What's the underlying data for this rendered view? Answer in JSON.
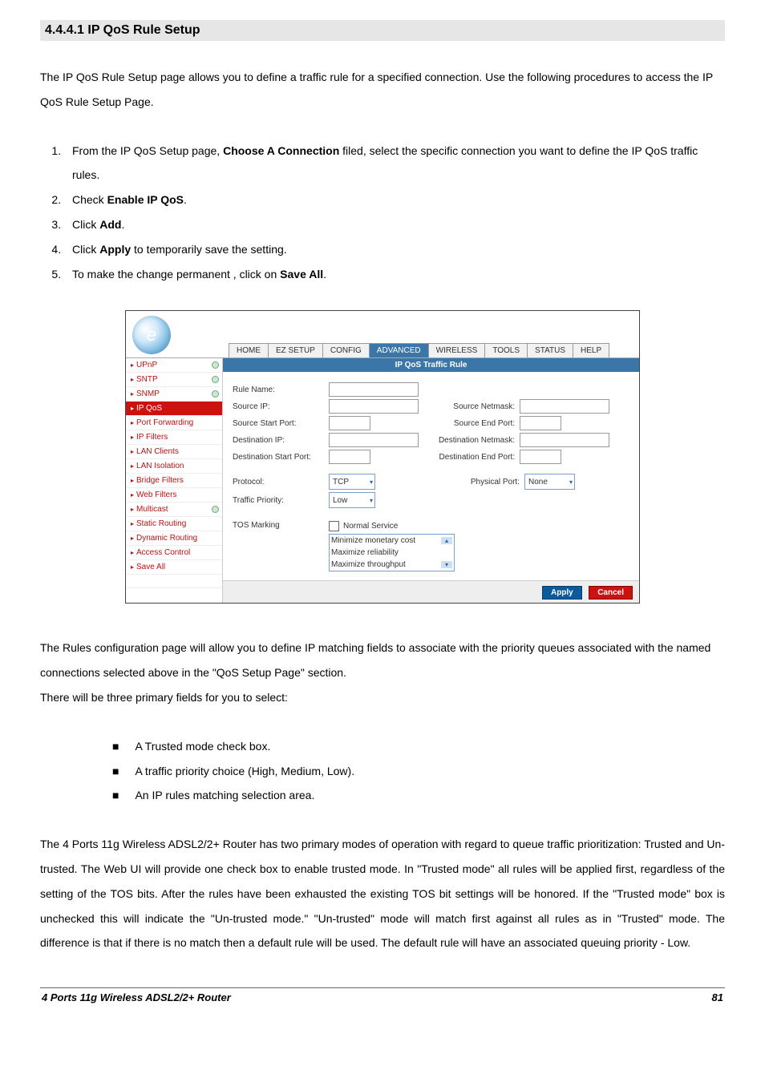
{
  "section_heading": "4.4.4.1 IP QoS Rule Setup",
  "intro_para": "The IP QoS Rule Setup page allows you to define a traffic rule for a specified connection. Use the following procedures to access the IP QoS Rule Setup Page.",
  "steps": {
    "s1_a": "From the IP QoS Setup page, ",
    "s1_b": "Choose A Connection",
    "s1_c": " filed, select the specific connection you want to define the IP QoS traffic rules.",
    "s2_a": "Check ",
    "s2_b": "Enable IP QoS",
    "s2_c": ".",
    "s3_a": "Click ",
    "s3_b": "Add",
    "s3_c": ".",
    "s4_a": "Click ",
    "s4_b": "Apply",
    "s4_c": " to temporarily save the setting.",
    "s5_a": "To make the change permanent , click on ",
    "s5_b": "Save All",
    "s5_c": "."
  },
  "shot": {
    "logo_letter": "e",
    "tabs": [
      "HOME",
      "EZ SETUP",
      "CONFIG",
      "ADVANCED",
      "WIRELESS",
      "TOOLS",
      "STATUS",
      "HELP"
    ],
    "active_tab_index": 3,
    "sidebar": [
      {
        "label": "UPnP",
        "dot": true
      },
      {
        "label": "SNTP",
        "dot": true
      },
      {
        "label": "SNMP",
        "dot": true
      },
      {
        "label": "IP QoS",
        "dot": false,
        "active": true
      },
      {
        "label": "Port Forwarding",
        "dot": false
      },
      {
        "label": "IP Filters",
        "dot": false
      },
      {
        "label": "LAN Clients",
        "dot": false
      },
      {
        "label": "LAN Isolation",
        "dot": false
      },
      {
        "label": "Bridge Filters",
        "dot": false
      },
      {
        "label": "Web Filters",
        "dot": false
      },
      {
        "label": "Multicast",
        "dot": true
      },
      {
        "label": "Static Routing",
        "dot": false
      },
      {
        "label": "Dynamic Routing",
        "dot": false
      },
      {
        "label": "Access Control",
        "dot": false
      },
      {
        "label": "Save All",
        "dot": false
      }
    ],
    "panel_title": "IP QoS Traffic Rule",
    "labels": {
      "rule_name": "Rule Name:",
      "source_ip": "Source IP:",
      "source_netmask": "Source Netmask:",
      "source_start_port": "Source Start Port:",
      "source_end_port": "Source End Port:",
      "dest_ip": "Destination IP:",
      "dest_netmask": "Destination Netmask:",
      "dest_start_port": "Destination Start Port:",
      "dest_end_port": "Destination End Port:",
      "protocol": "Protocol:",
      "physical_port": "Physical Port:",
      "traffic_priority": "Traffic Priority:",
      "tos_marking": "TOS Marking",
      "normal_service": "Normal Service"
    },
    "selects": {
      "protocol": "TCP",
      "traffic_priority": "Low",
      "physical_port": "None"
    },
    "tos_options": [
      "Minimize monetary cost",
      "Maximize reliability",
      "Maximize throughput"
    ],
    "buttons": {
      "apply": "Apply",
      "cancel": "Cancel"
    }
  },
  "after_para": "The Rules configuration page will allow you to define IP matching fields to associate with the priority queues associated with the named connections selected above in the \"QoS Setup Page\" section.",
  "after_para2": "There will be three primary fields for you to select:",
  "bullets": [
    "A Trusted mode check box.",
    "A traffic priority choice (High, Medium, Low).",
    "An IP rules matching selection area."
  ],
  "long_para": "The 4 Ports 11g Wireless ADSL2/2+ Router has two primary modes of operation with regard to queue traffic prioritization: Trusted and Un-trusted. The Web UI will provide one check box to enable trusted mode. In \"Trusted mode\" all rules will be applied first, regardless of the setting of the TOS bits. After the rules have been exhausted the existing TOS bit settings will be honored. If the \"Trusted mode\" box is unchecked this will indicate the \"Un-trusted mode.\" \"Un-trusted\" mode will match first against all rules as in \"Trusted\" mode. The difference is that if there is no match then a default rule will be used. The default rule will have an associated queuing priority - Low.",
  "footer": {
    "title": "4 Ports 11g Wireless ADSL2/2+ Router",
    "page": "81"
  }
}
